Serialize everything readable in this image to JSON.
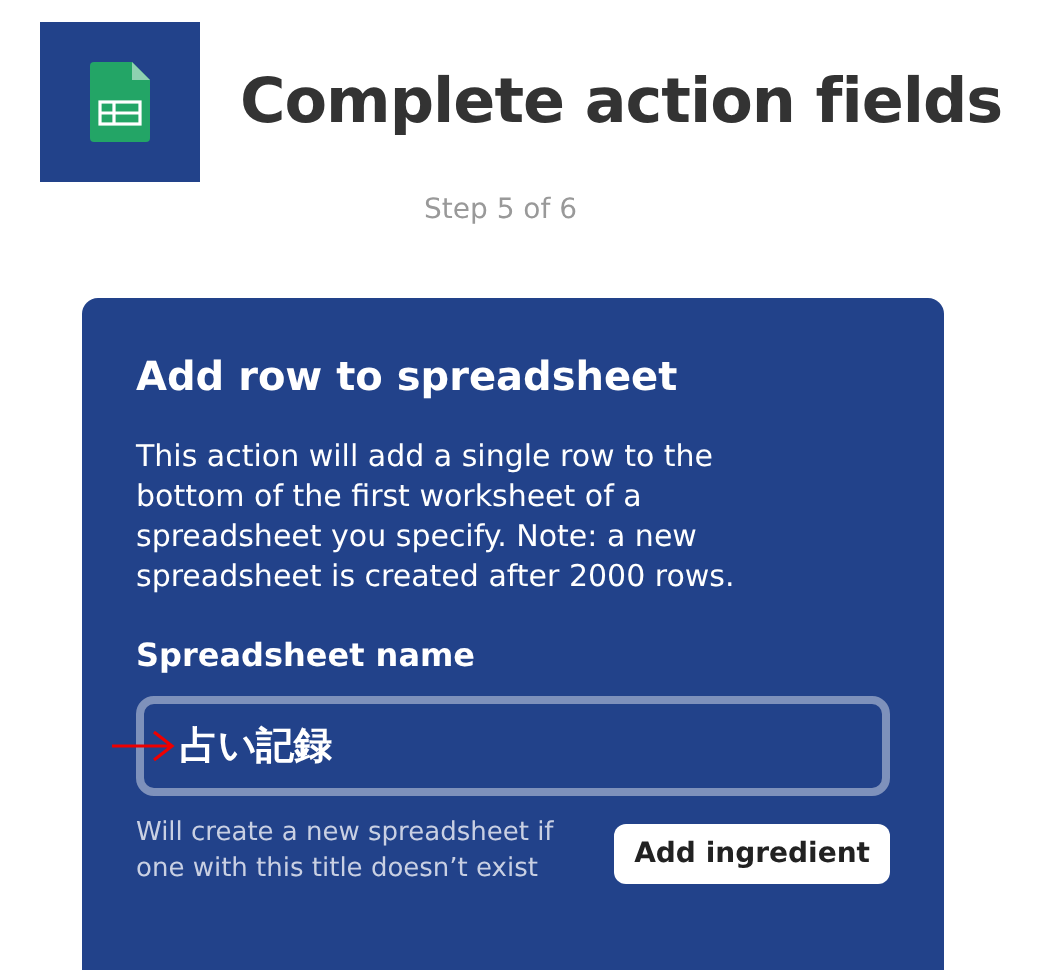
{
  "header": {
    "title": "Complete action fields",
    "step": "Step 5 of 6"
  },
  "card": {
    "title": "Add row to spreadsheet",
    "description": "This action will add a single row to the bottom of the first worksheet of a spreadsheet you specify. Note: a new spreadsheet is created after 2000 rows.",
    "field": {
      "label": "Spreadsheet name",
      "value": "占い記録",
      "help": "Will create a new spreadsheet if one with this title doesn’t exist",
      "button": "Add ingredient"
    }
  }
}
